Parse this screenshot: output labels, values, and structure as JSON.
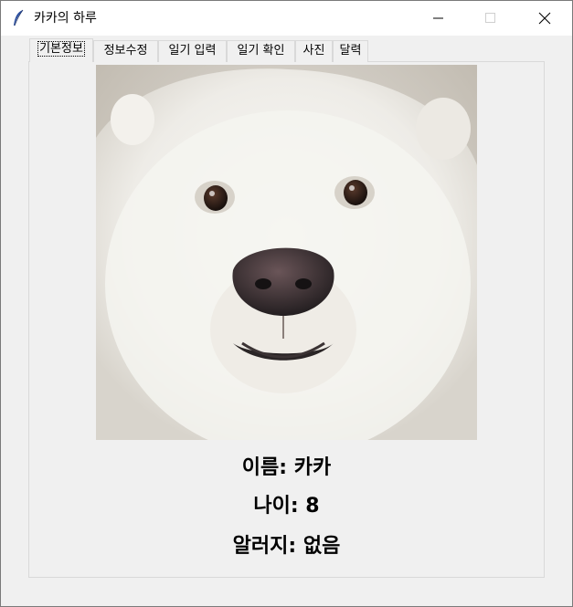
{
  "window": {
    "title": "카카의 하루",
    "icon": "feather-icon",
    "controls": [
      "minimize-icon",
      "maximize-icon",
      "close-icon"
    ]
  },
  "tabs": [
    {
      "label": "기본정보",
      "selected": true
    },
    {
      "label": "정보수정",
      "selected": false
    },
    {
      "label": "일기 입력",
      "selected": false
    },
    {
      "label": "일기 확인",
      "selected": false
    },
    {
      "label": "사진",
      "selected": false
    },
    {
      "label": "달력",
      "selected": false
    }
  ],
  "profile": {
    "photo": "white samoyed dog portrait",
    "name_line": "이름: 카카",
    "age_line": "나이: 8",
    "allergy_line": "알러지: 없음"
  }
}
